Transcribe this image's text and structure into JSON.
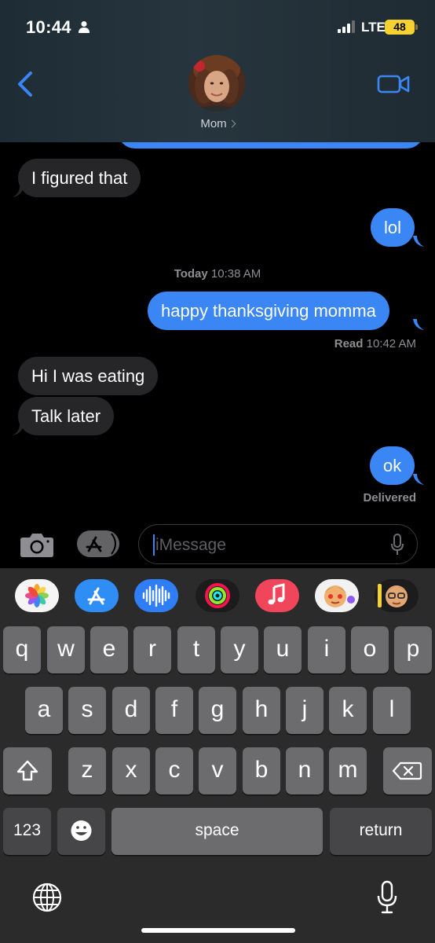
{
  "status_bar": {
    "time": "10:44",
    "network": "LTE",
    "battery": "48"
  },
  "header": {
    "contact_name": "Mom"
  },
  "messages": [
    {
      "text": "I figured that"
    },
    {
      "text": "lol"
    },
    {
      "text": "happy thanksgiving momma"
    },
    {
      "text": "Hi I was eating"
    },
    {
      "text": "Talk later"
    },
    {
      "text": "ok"
    }
  ],
  "timestamp": {
    "day": "Today",
    "time": "10:38 AM"
  },
  "read_receipt": {
    "label": "Read",
    "time": "10:42 AM"
  },
  "delivered_label": "Delivered",
  "input": {
    "placeholder": "iMessage"
  },
  "app_strip": [
    "photos-icon",
    "app-store-icon",
    "audio-message-icon",
    "activity-icon",
    "music-icon",
    "memoji-icon",
    "memoji-2-icon"
  ],
  "keyboard": {
    "row1": [
      "q",
      "w",
      "e",
      "r",
      "t",
      "y",
      "u",
      "i",
      "o",
      "p"
    ],
    "row2": [
      "a",
      "s",
      "d",
      "f",
      "g",
      "h",
      "j",
      "k",
      "l"
    ],
    "row3": [
      "z",
      "x",
      "c",
      "v",
      "b",
      "n",
      "m"
    ],
    "numbers": "123",
    "space": "space",
    "return": "return"
  },
  "colors": {
    "outgoing_bubble": "#3a86f5",
    "incoming_bubble": "#262629",
    "battery": "#f5d131"
  }
}
